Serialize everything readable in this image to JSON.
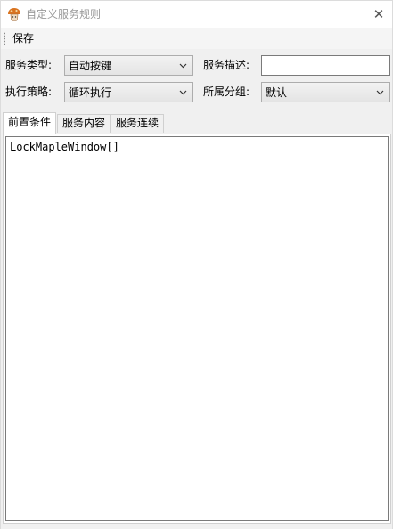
{
  "window": {
    "title": "自定义服务规则",
    "close_symbol": "✕",
    "app_icon": "mushroom-icon"
  },
  "toolbar": {
    "save_label": "保存"
  },
  "form": {
    "service_type_label": "服务类型:",
    "service_type_value": "自动按键",
    "service_desc_label": "服务描述:",
    "service_desc_value": "",
    "strategy_label": "执行策略:",
    "strategy_value": "循环执行",
    "group_label": "所属分组:",
    "group_value": "默认"
  },
  "tabs": [
    {
      "label": "前置条件",
      "active": true
    },
    {
      "label": "服务内容",
      "active": false
    },
    {
      "label": "服务连续",
      "active": false
    }
  ],
  "editor": {
    "content": "LockMapleWindow[]"
  },
  "colors": {
    "window_bg": "#f0f0f0",
    "title_text": "#9a9a9a",
    "field_border": "#adadad"
  }
}
